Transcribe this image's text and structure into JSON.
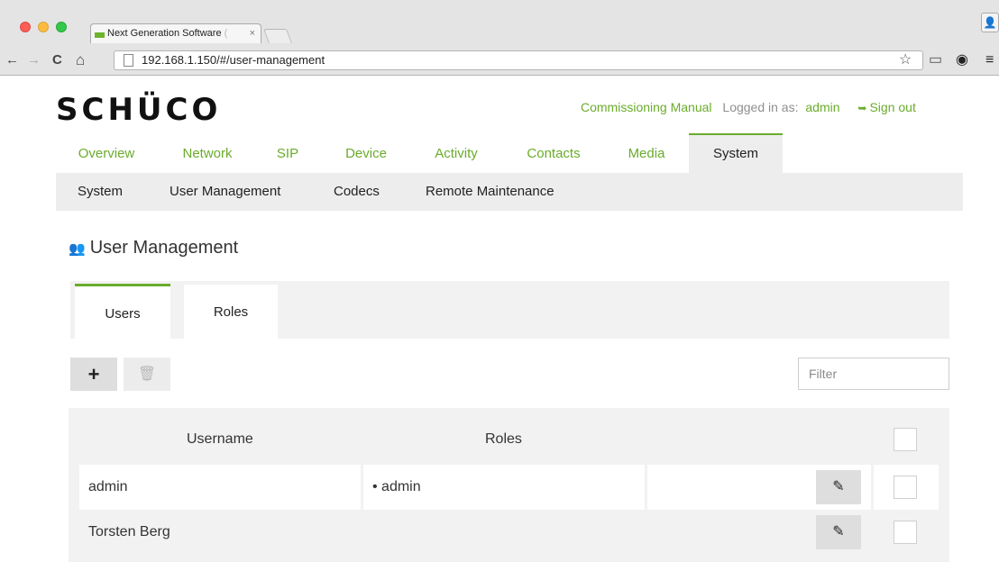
{
  "browser": {
    "tab_title": "Next Generation Software",
    "tab_title_fade": " (",
    "tab_close": "×",
    "url": "192.168.1.150/#/user-management",
    "nav": {
      "back": "←",
      "forward": "→",
      "reload": "C",
      "home": "⌂"
    },
    "icons": {
      "star": "☆",
      "cast": "▭",
      "extension": "◉",
      "menu": "≡",
      "profile": "👤"
    }
  },
  "brand": {
    "logo_text": "SCHÜCO"
  },
  "header": {
    "commissioning_manual": "Commissioning Manual",
    "logged_in_label": "Logged in as:",
    "username": "admin",
    "sign_out": "Sign out",
    "sign_out_icon": "➥"
  },
  "main_nav": [
    {
      "label": "Overview"
    },
    {
      "label": "Network"
    },
    {
      "label": "SIP"
    },
    {
      "label": "Device"
    },
    {
      "label": "Activity"
    },
    {
      "label": "Contacts"
    },
    {
      "label": "Media"
    },
    {
      "label": "System"
    }
  ],
  "active_main_nav": "System",
  "sub_nav": [
    {
      "label": "System"
    },
    {
      "label": "User Management"
    },
    {
      "label": "Codecs"
    },
    {
      "label": "Remote Maintenance"
    }
  ],
  "page": {
    "title": "User Management",
    "title_icon": "👥",
    "tabs": [
      {
        "label": "Users"
      },
      {
        "label": "Roles"
      }
    ],
    "active_tab": "Users"
  },
  "toolbar": {
    "add_icon": "+",
    "delete_icon": "🗑",
    "filter_placeholder": "Filter"
  },
  "table": {
    "columns": {
      "username": "Username",
      "roles": "Roles"
    },
    "rows": [
      {
        "username": "admin",
        "roles": "•  admin"
      },
      {
        "username": "Torsten Berg",
        "roles": ""
      }
    ],
    "edit_icon": "✎"
  },
  "colors": {
    "accent_green": "#6aac2b",
    "nav_bg": "#ededed",
    "panel_bg": "#f2f2f2",
    "button_bg": "#dedede"
  }
}
